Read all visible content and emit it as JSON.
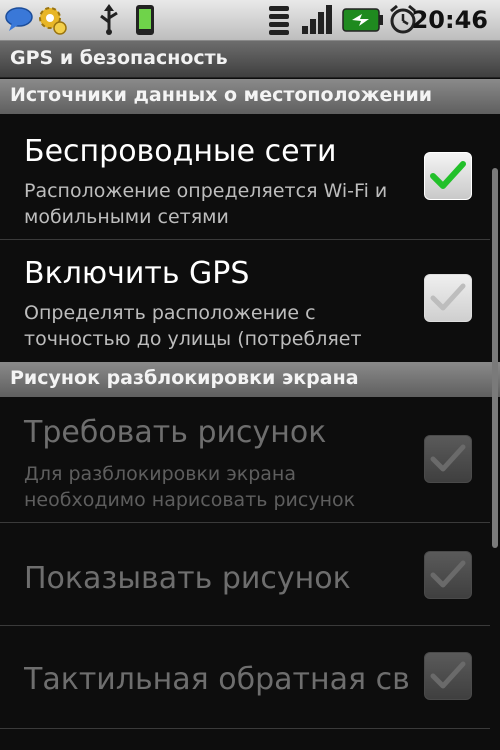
{
  "status_bar": {
    "time": "20:46",
    "icons": [
      "chat-icon",
      "gear-icon",
      "usb-icon",
      "phone-icon",
      "wifi-icon",
      "signal-icon",
      "battery-icon",
      "alarm-icon"
    ]
  },
  "title": "GPS и безопасность",
  "sections": [
    {
      "header": "Источники данных о местоположении",
      "items": [
        {
          "title": "Беспроводные сети",
          "summary": "Расположение определяется Wi-Fi и мобильными сетями",
          "checked": true,
          "enabled": true
        },
        {
          "title": "Включить GPS",
          "summary": "Определять расположение с точностью до улицы (потребляет",
          "checked": false,
          "enabled": true
        }
      ]
    },
    {
      "header": "Рисунок разблокировки экрана",
      "items": [
        {
          "title": "Требовать рисунок",
          "summary": "Для разблокировки экрана необходимо нарисовать рисунок",
          "checked": false,
          "enabled": false
        },
        {
          "title": "Показывать рисунок",
          "summary": "",
          "checked": false,
          "enabled": false
        },
        {
          "title": "Тактильная обратная св",
          "summary": "",
          "checked": false,
          "enabled": false
        }
      ]
    }
  ],
  "colors": {
    "checkmark": "#22c02a",
    "background": "#0d0d0d"
  }
}
